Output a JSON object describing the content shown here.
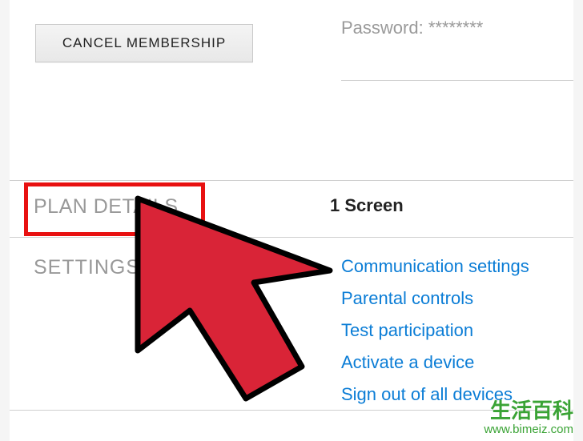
{
  "membership": {
    "cancel_button": "CANCEL MEMBERSHIP",
    "password_label": "Password:",
    "password_mask": "********"
  },
  "sections": {
    "plan_details_label": "PLAN DETAILS",
    "plan_value": "1 Screen",
    "settings_label": "SETTINGS"
  },
  "settings_links": {
    "communication": "Communication settings",
    "parental": "Parental controls",
    "participation": "Test participation",
    "activate": "Activate a device",
    "signout": "Sign out of all devices"
  },
  "watermark": {
    "line1": "生活百科",
    "line2": "www.bimeiz.com"
  }
}
